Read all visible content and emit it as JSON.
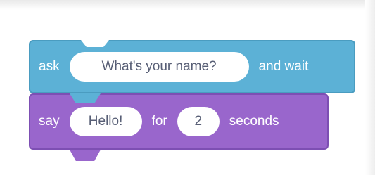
{
  "blocks": {
    "ask": {
      "keyword": "ask",
      "question_value": "What's your name?",
      "suffix": "and wait",
      "color": "#5cb1d6"
    },
    "say": {
      "keyword": "say",
      "message_value": "Hello!",
      "middle": "for",
      "seconds_value": "2",
      "suffix": "seconds",
      "color": "#9966cc"
    }
  }
}
